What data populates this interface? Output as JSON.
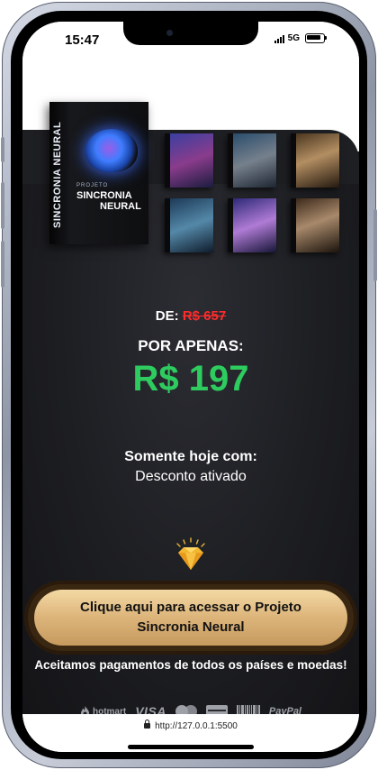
{
  "status_bar": {
    "time": "15:47",
    "network": "5G"
  },
  "products": {
    "main_box": {
      "spine": "SINCRONIA NEURAL",
      "small_label": "PROJETO",
      "title_line1": "SINCRONIA",
      "title_line2": "NEURAL"
    }
  },
  "pricing": {
    "from_label": "DE:",
    "old_price": "R$ 657",
    "for_label": "POR APENAS:",
    "new_price": "R$ 197",
    "colors": {
      "old": "#ff2b2b",
      "new": "#2ecc5f"
    }
  },
  "offer": {
    "title": "Somente hoje com:",
    "subtitle": "Desconto ativado"
  },
  "icons": {
    "diamond": "diamond-icon"
  },
  "cta": {
    "label": "Clique aqui para acessar o Projeto Sincronia Neural"
  },
  "payments": {
    "text": "Aceitamos pagamentos de todos os países e moedas!",
    "logos": [
      "hotmart",
      "VISA",
      "mastercard",
      "card",
      "boleto",
      "PayPal"
    ]
  },
  "browser": {
    "url": "http://127.0.0.1:5500"
  }
}
